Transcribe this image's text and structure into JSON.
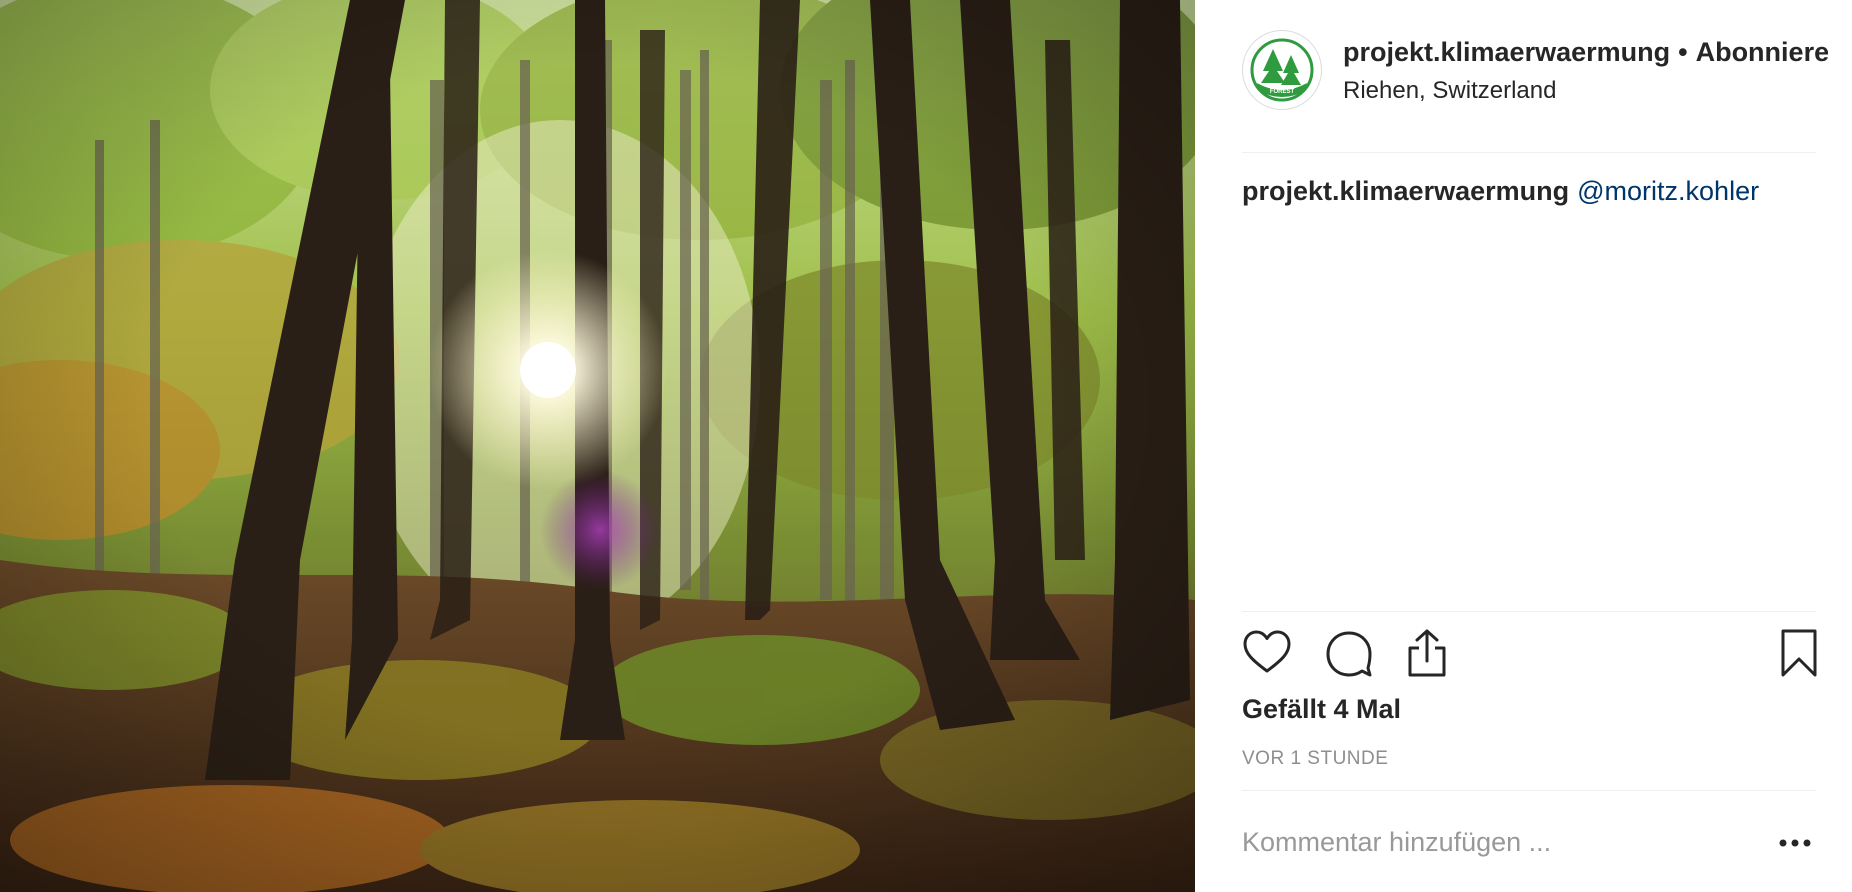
{
  "post": {
    "username": "projekt.klimaerwaermung",
    "separator": "•",
    "follow_label": "Abonnieren",
    "location": "Riehen, Switzerland",
    "avatar_text": "FOREST",
    "caption": {
      "username": "projekt.klimaerwaermung",
      "mention": "@moritz.kohler"
    },
    "likes_text": "Gefällt 4 Mal",
    "timestamp": "VOR 1 STUNDE",
    "comment_placeholder": "Kommentar hinzufügen ..."
  },
  "colors": {
    "mention": "#003569",
    "muted": "#8e8e8e",
    "divider": "#efefef",
    "avatar_green": "#2e9b3e"
  },
  "icons": [
    "heart-icon",
    "comment-icon",
    "share-icon",
    "bookmark-icon",
    "more-options-icon"
  ]
}
